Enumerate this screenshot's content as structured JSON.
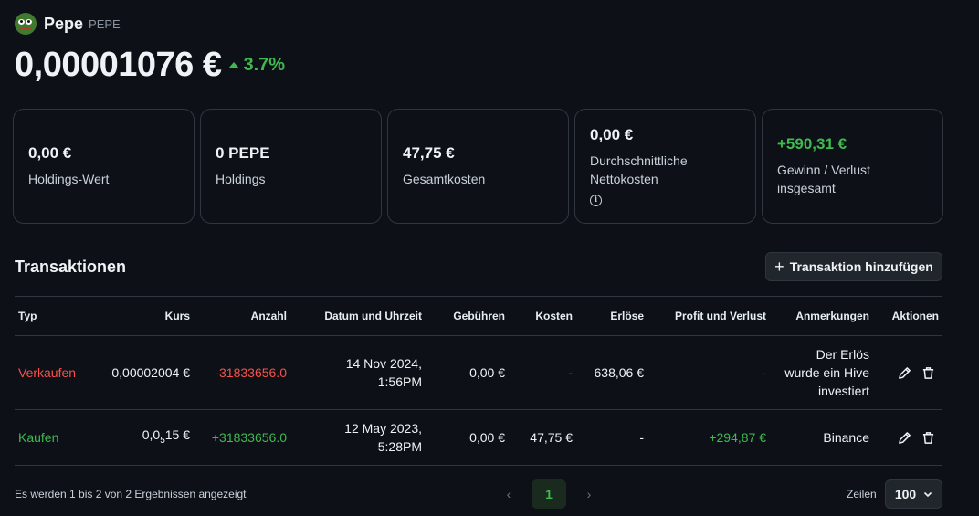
{
  "coin": {
    "name": "Pepe",
    "symbol": "PEPE",
    "price": "0,00001076 €",
    "change": "3.7%"
  },
  "cards": [
    {
      "value": "0,00 €",
      "label": "Holdings-Wert"
    },
    {
      "value": "0 PEPE",
      "label": "Holdings"
    },
    {
      "value": "47,75 €",
      "label": "Gesamtkosten"
    },
    {
      "value": "0,00 €",
      "label1": "Durchschnittliche",
      "label2": "Nettokosten"
    },
    {
      "value": "+590,31 €",
      "label1": "Gewinn / Verlust",
      "label2": "insgesamt"
    }
  ],
  "transactions": {
    "title": "Transaktionen",
    "add_label": "Transaktion hinzufügen",
    "columns": [
      "Typ",
      "Kurs",
      "Anzahl",
      "Datum und Uhrzeit",
      "Gebühren",
      "Kosten",
      "Erlöse",
      "Profit und Verlust",
      "Anmerkungen",
      "Aktionen"
    ],
    "rows": [
      {
        "type": "Verkaufen",
        "price": "0,00002004 €",
        "amount": "-31833656.0",
        "date1": "14 Nov 2024,",
        "date2": "1:56PM",
        "fees": "0,00 €",
        "cost": "-",
        "proceeds": "638,06 €",
        "pnl": "-",
        "note1": "Der Erlös",
        "note2": "wurde ein Hive",
        "note3": "investiert"
      },
      {
        "type": "Kaufen",
        "price_a": "0,0",
        "price_sub": "5",
        "price_b": "15 €",
        "amount": "+31833656.0",
        "date1": "12 May 2023,",
        "date2": "5:28PM",
        "fees": "0,00 €",
        "cost": "47,75 €",
        "proceeds": "-",
        "pnl": "+294,87 €",
        "note1": "Binance"
      }
    ]
  },
  "footer": {
    "summary": "Es werden 1 bis 2 von 2 Ergebnissen angezeigt",
    "page": "1",
    "rows_label": "Zeilen",
    "rows_value": "100"
  },
  "colors": {
    "positive": "#3fb950",
    "negative": "#f85149",
    "background": "#0d1117"
  }
}
